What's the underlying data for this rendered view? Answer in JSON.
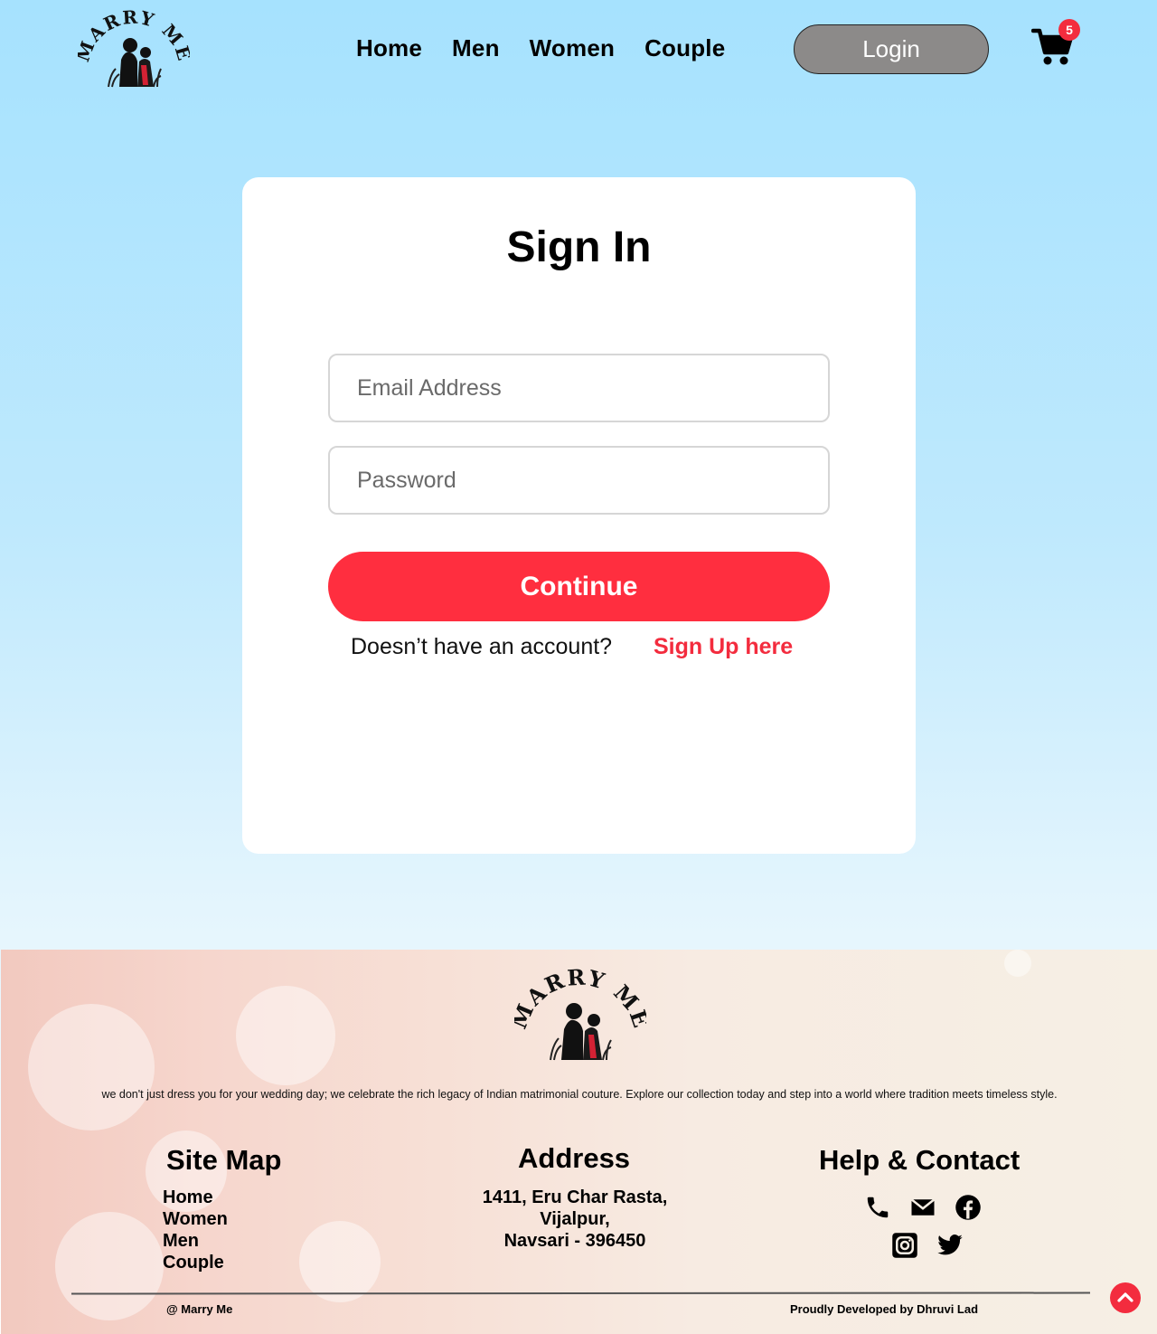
{
  "header": {
    "logo_text": "MARRY ME",
    "nav": [
      "Home",
      "Men",
      "Women",
      "Couple"
    ],
    "login_label": "Login",
    "cart_count": "5"
  },
  "signin": {
    "title": "Sign In",
    "email_placeholder": "Email Address",
    "password_placeholder": "Password",
    "continue_label": "Continue",
    "no_account_text": "Doesn’t have an account?",
    "signup_label": "Sign Up here"
  },
  "footer": {
    "logo_text": "MARRY ME",
    "tagline": "we don't just dress you for your wedding day; we celebrate the rich legacy of Indian matrimonial couture. Explore our collection today and step into a world where tradition meets timeless style.",
    "sitemap_title": "Site Map",
    "sitemap_links": [
      "Home",
      "Women",
      "Men",
      "Couple"
    ],
    "address_title": "Address",
    "address_lines": [
      "1411, Eru Char Rasta,",
      "Vijalpur,",
      "Navsari - 396450"
    ],
    "help_title": "Help & Contact",
    "social_icons": [
      "phone-icon",
      "mail-icon",
      "facebook-icon",
      "instagram-icon",
      "twitter-icon"
    ],
    "copyright": "@ Marry Me",
    "credit": "Proudly Developed by Dhruvi Lad"
  },
  "colors": {
    "accent": "#ff2e3f",
    "login_bg": "#8c8a89",
    "sky_top": "#a6e2fe"
  }
}
